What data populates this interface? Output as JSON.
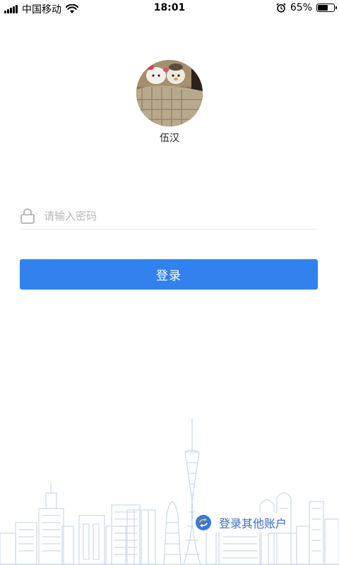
{
  "status_bar": {
    "carrier": "中国移动",
    "time": "18:01",
    "battery": "65%",
    "battery_level": 0.65
  },
  "profile": {
    "username": "伍汉"
  },
  "password": {
    "placeholder": "请输入密码",
    "value": ""
  },
  "login": {
    "label": "登录"
  },
  "other_account": {
    "label": "登录其他账户"
  },
  "colors": {
    "primary": "#3381ee",
    "link": "#3a6ec8",
    "skyline": "#c9d9ee"
  }
}
